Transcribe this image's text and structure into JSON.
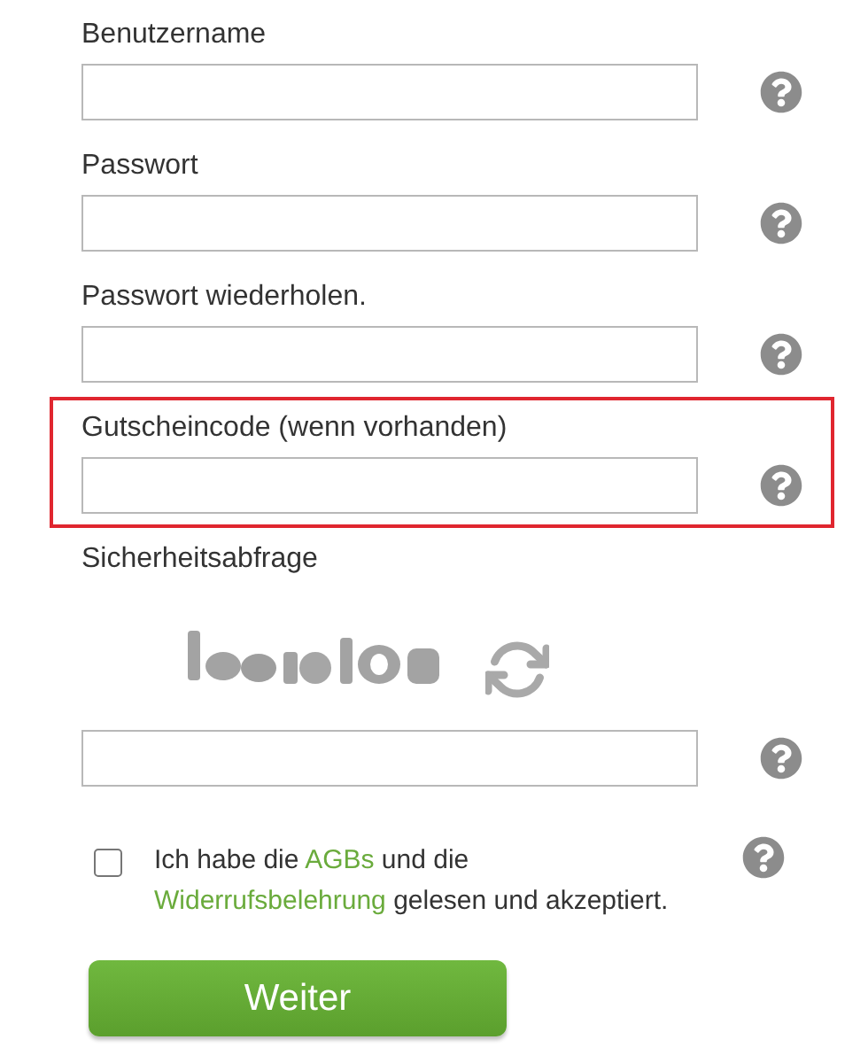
{
  "fields": [
    {
      "label": "Benutzername",
      "highlighted": false
    },
    {
      "label": "Passwort",
      "highlighted": false
    },
    {
      "label": "Passwort wiederholen.",
      "highlighted": false
    },
    {
      "label": "Gutscheincode (wenn vorhanden)",
      "highlighted": true
    }
  ],
  "captcha": {
    "label": "Sicherheitsabfrage"
  },
  "consent": {
    "checked": false,
    "parts": [
      {
        "kind": "text",
        "text": "Ich habe die "
      },
      {
        "kind": "link",
        "text": "AGBs"
      },
      {
        "kind": "text",
        "text": " und die "
      },
      {
        "kind": "break"
      },
      {
        "kind": "link",
        "text": "Widerrufsbelehrung"
      },
      {
        "kind": "text",
        "text": " gelesen und akzeptiert."
      }
    ]
  },
  "submit": {
    "label": "Weiter"
  }
}
